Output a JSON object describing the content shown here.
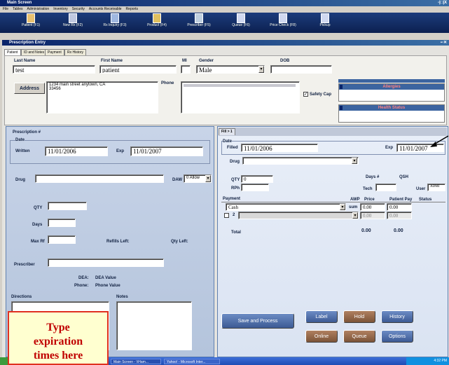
{
  "main_window": {
    "title": "Main Screen",
    "close": "-|□|X"
  },
  "menu": [
    "File",
    "Tables",
    "Administration",
    "Inventory",
    "Security",
    "Accounts Receivable",
    "Reports"
  ],
  "toolbar": [
    {
      "label": "Patient (F1)",
      "icon": "patient-icon"
    },
    {
      "label": "New Rx (F2)",
      "icon": "new-rx-icon"
    },
    {
      "label": "Rx Inquiry (F3)",
      "icon": "rx-inquiry-icon"
    },
    {
      "label": "Product (F4)",
      "icon": "product-icon"
    },
    {
      "label": "Prescriber (F5)",
      "icon": "prescriber-icon"
    },
    {
      "label": "Queue (F6)",
      "icon": "queue-icon"
    },
    {
      "label": "Price Check (F8)",
      "icon": "price-check-icon"
    },
    {
      "label": "Pickup",
      "icon": "pickup-icon"
    }
  ],
  "rx_window": {
    "title": "Prescription Entry"
  },
  "tabs": [
    "Patient",
    "ID and Notes",
    "Payment",
    "Rx History"
  ],
  "patient": {
    "last_name_label": "Last Name",
    "last_name": "test",
    "first_name_label": "First Name",
    "first_name": "patient",
    "mi_label": "MI",
    "mi": "",
    "gender_label": "Gender",
    "gender": "Male",
    "dob_label": "DOB",
    "dob": "",
    "address_button": "Address",
    "address_line1": "1234 main street anytown, CA",
    "address_line2": "33456",
    "phone_label": "Phone",
    "safety_cap_label": "Safety Cap",
    "allergies_label": "Allergies",
    "health_status_label": "Health Status"
  },
  "prescription": {
    "header": "Prescription #",
    "date_group": "Date",
    "written_label": "Written",
    "written": "11/01/2006",
    "exp_label": "Exp",
    "exp": "11/01/2007",
    "drug_label": "Drug",
    "daw_label": "DAW",
    "daw_value": "0 Allow",
    "qty_label": "QTY",
    "days_label": "Days",
    "max_rf_label": "Max Rf",
    "refills_left_label": "Refills Left:",
    "qty_left_label": "Qty Left:",
    "prescriber_label": "Prescriber",
    "dea_label": "DEA:",
    "dea_value": "DEA Value",
    "phone_label": "Phone:",
    "phone_value": "Phone Value",
    "directions_label": "Directions",
    "notes_label": "Notes"
  },
  "fill": {
    "tab": "Fill > 1",
    "date_group": "Date",
    "filled_label": "Filled",
    "filled": "11/01/2006",
    "exp_label": "Exp",
    "exp": "11/01/2007",
    "drug_label": "Drug",
    "qty_label": "QTY",
    "qty": "0",
    "rph_label": "RPh",
    "days_label": "Days #",
    "qsh_label": "QSH",
    "tech_label": "Tech",
    "user_label": "User",
    "user_value": "ADMI",
    "payment_label": "Payment",
    "awp_label": "AWP",
    "price_label": "Price",
    "patient_pay_label": "Patient Pay",
    "status_label": "Status",
    "payment1": "Cash",
    "sum_label": "sum",
    "price1": "0.00",
    "pay1": "0.00",
    "payment2_num": "2",
    "price2": "0.00",
    "pay2": "0.00",
    "total_label": "Total",
    "total_price": "0.00",
    "total_pay": "0.00"
  },
  "buttons": {
    "save_process": "Save and Process",
    "label": "Label",
    "hold": "Hold",
    "history": "History",
    "online": "Online",
    "queue": "Queue",
    "options": "Options"
  },
  "callout": {
    "line1": "Type",
    "line2": "expiration",
    "line3": "times here"
  },
  "taskbar": {
    "item1": "Main Screen - \\\\Ham...",
    "item2": "Yahoo! - Microsoft Inter...",
    "tray": "4:32 PM"
  },
  "colors": {
    "title_bar": "#0a246a",
    "panel_blue": "#3c64a0",
    "callout_text": "#c00000",
    "callout_border": "#e03020"
  }
}
